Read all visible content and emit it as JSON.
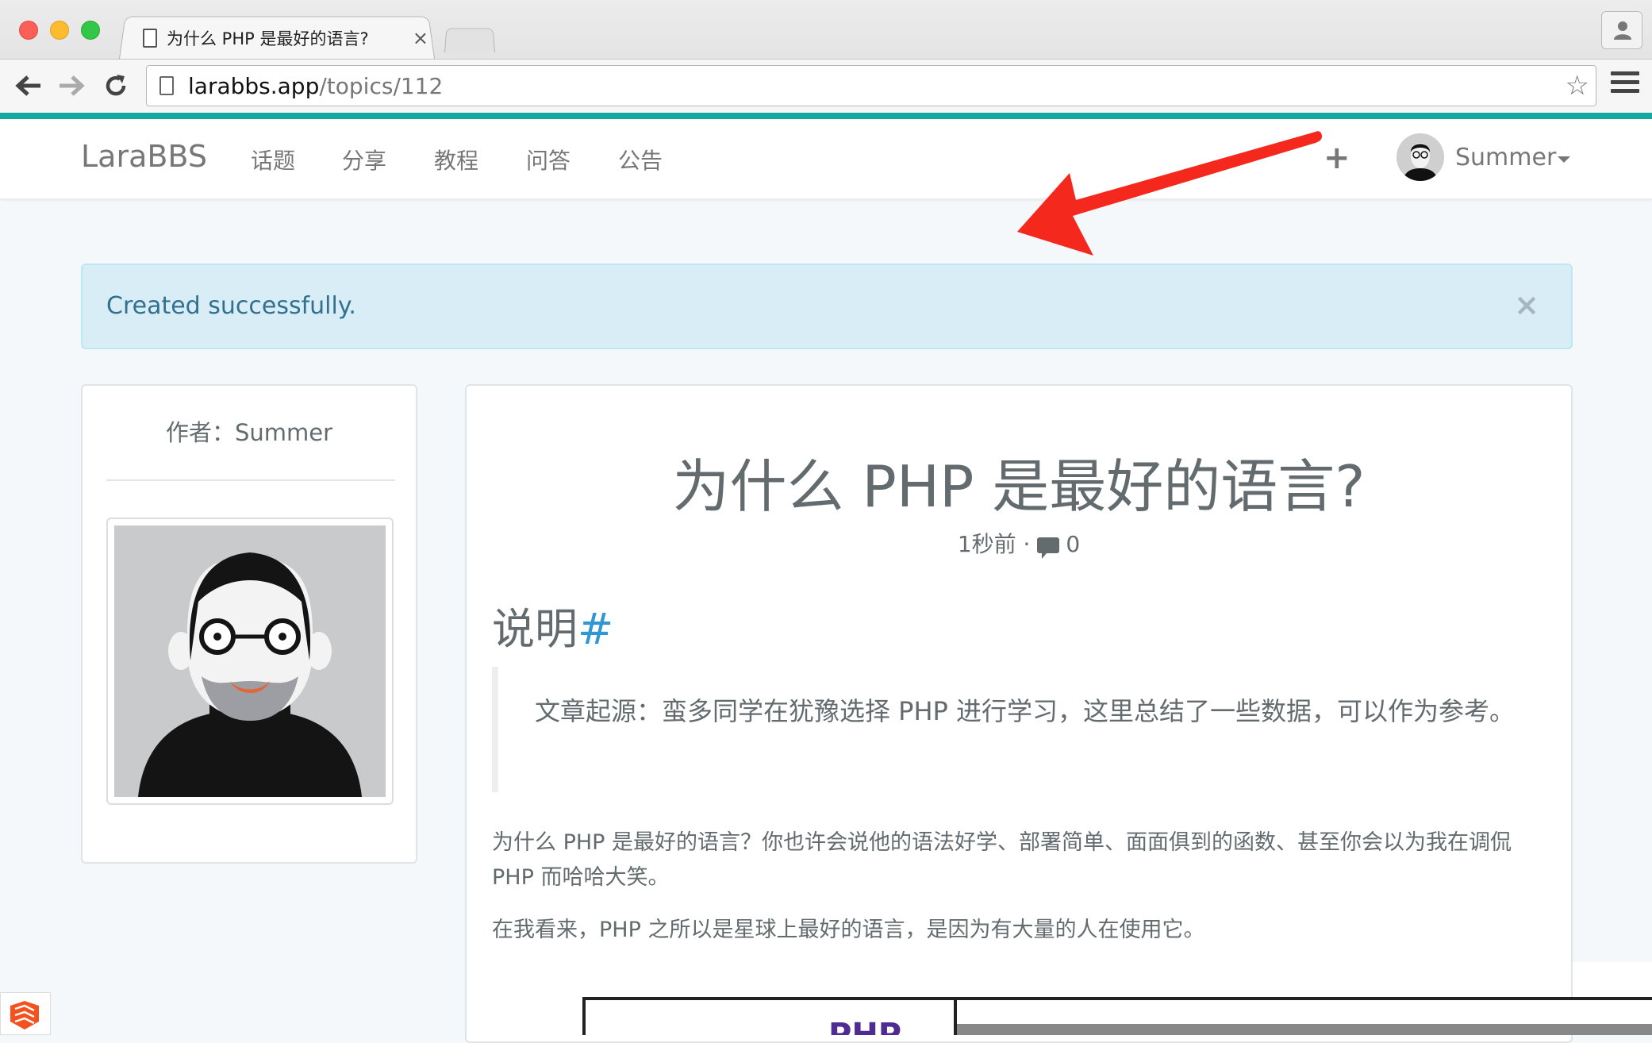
{
  "browser": {
    "tab_title": "为什么 PHP 是最好的语言?",
    "tab_close": "×",
    "url_host": "larabbs.app",
    "url_path": "/topics/112",
    "star": "☆"
  },
  "navbar": {
    "brand": "LaraBBS",
    "links": [
      "话题",
      "分享",
      "教程",
      "问答",
      "公告"
    ],
    "plus": "+",
    "user_name": "Summer"
  },
  "alert": {
    "message": "Created successfully.",
    "close": "×"
  },
  "author": {
    "label": "作者：Summer"
  },
  "topic": {
    "title": "为什么 PHP 是最好的语言?",
    "time": "1秒前",
    "separator": " · ",
    "reply_count": "0",
    "section_heading": "说明",
    "heading_anchor": "#",
    "blockquote": "文章起源：蛮多同学在犹豫选择 PHP 进行学习，这里总结了一些数据，可以作为参考。",
    "paragraph1": "为什么 PHP 是最好的语言？你也许会说他的语法好学、部署简单、面面俱到的函数、甚至你会以为我在调侃 PHP 而哈哈大笑。",
    "paragraph2": "在我看来，PHP 之所以是星球上最好的语言，是因为有大量的人在使用它。",
    "image_text": "PHP"
  },
  "colors": {
    "accent_bar": "#14a9a0",
    "alert_bg": "#d9edf7",
    "alert_text": "#31708f",
    "anchor": "#3097d1",
    "arrow": "#f5281e"
  }
}
